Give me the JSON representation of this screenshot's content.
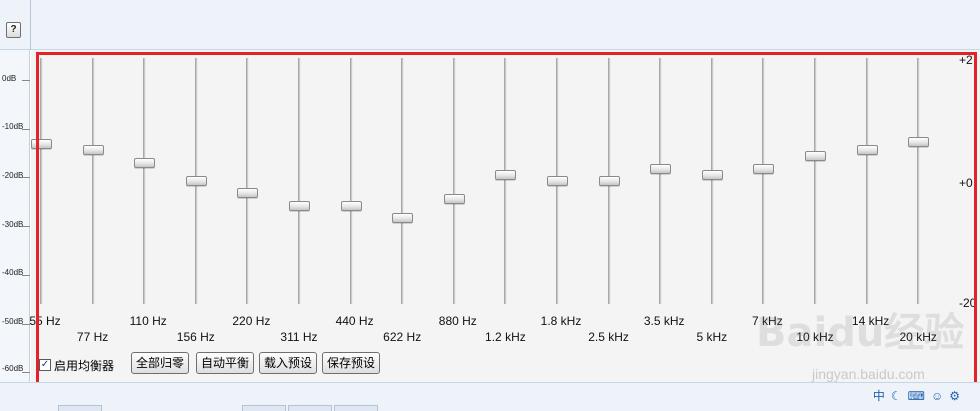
{
  "toolbar": {
    "help_label": "?"
  },
  "left_scale": [
    "0dB",
    "-10dB",
    "-20dB",
    "-30dB",
    "-40dB",
    "-50dB",
    "-60dB"
  ],
  "right_scale": {
    "top": "+2",
    "mid": "+0",
    "bottom": "-20"
  },
  "bands_row1": [
    "55 Hz",
    "110 Hz",
    "220 Hz",
    "440 Hz",
    "880 Hz",
    "1.8 kHz",
    "3.5 kHz",
    "7 kHz",
    "14 kHz"
  ],
  "bands_row2": [
    "77 Hz",
    "156 Hz",
    "311 Hz",
    "622 Hz",
    "1.2 kHz",
    "2.5 kHz",
    "5 kHz",
    "10 kHz",
    "20 kHz"
  ],
  "slider_levels": [
    0.65,
    0.625,
    0.575,
    0.5,
    0.45,
    0.4,
    0.4,
    0.35,
    0.425,
    0.525,
    0.5,
    0.5,
    0.55,
    0.525,
    0.55,
    0.6,
    0.625,
    0.66
  ],
  "controls": {
    "enable_label": "启用均衡器",
    "enable_checked": "✓",
    "reset_label": "全部归零",
    "auto_label": "自动平衡",
    "load_label": "载入预设",
    "save_label": "保存预设"
  },
  "watermark": {
    "brand": "Baidu经验",
    "url": "jingyan.baidu.com"
  },
  "colors": {
    "annotation": "#e3222a",
    "background": "#f4f4f4"
  }
}
